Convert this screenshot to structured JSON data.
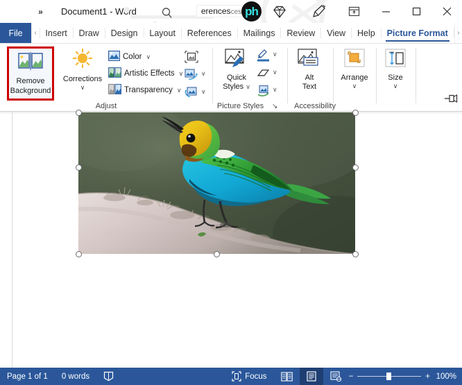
{
  "titlebar": {
    "qat_more": "»",
    "document_title": "Document1  -  Word",
    "search_fragment_main": "erences",
    "search_fragment_ghost": "ces",
    "logo_text": "ph",
    "ribbon_display_options": "ribbon-display-options",
    "minimize": "—",
    "maximize": "☐",
    "close": "✕"
  },
  "tabs": {
    "file": "File",
    "scroll_left": "‹",
    "scroll_right": "›",
    "items": [
      {
        "label": "Insert",
        "active": false
      },
      {
        "label": "Draw",
        "active": false
      },
      {
        "label": "Design",
        "active": false
      },
      {
        "label": "Layout",
        "active": false
      },
      {
        "label": "References",
        "active": false
      },
      {
        "label": "Mailings",
        "active": false
      },
      {
        "label": "Review",
        "active": false
      },
      {
        "label": "View",
        "active": false
      },
      {
        "label": "Help",
        "active": false
      },
      {
        "label": "Picture Format",
        "active": true
      }
    ]
  },
  "ribbon": {
    "groups": {
      "adjust": {
        "label": "Adjust",
        "remove_background": "Remove\nBackground",
        "remove_background_line1": "Remove",
        "remove_background_line2": "Background",
        "highlight_color": "#cc0000",
        "corrections": "Corrections",
        "color": "Color",
        "artistic_effects": "Artistic Effects",
        "transparency": "Transparency",
        "compress_pictures": "compress-pictures",
        "change_picture": "change-picture",
        "reset_picture": "reset-picture",
        "caret": "∨"
      },
      "picture_styles": {
        "label": "Picture Styles",
        "quick_styles_line1": "Quick",
        "quick_styles_line2": "Styles",
        "picture_border": "picture-border",
        "picture_effects": "picture-effects",
        "picture_layout": "picture-layout",
        "dialog_launcher": "↘",
        "caret": "∨"
      },
      "accessibility": {
        "label": "Accessibility",
        "alt_text_line1": "Alt",
        "alt_text_line2": "Text"
      },
      "arrange": {
        "label": "",
        "title": "Arrange",
        "caret": "∨"
      },
      "size": {
        "label": "",
        "title": "Size",
        "caret": "∨"
      }
    },
    "pin_ribbon": "pin-ribbon"
  },
  "document": {
    "image": {
      "alt": "Colorful tanager bird perched on a mossy branch",
      "selected": true,
      "handles": 8
    }
  },
  "statusbar": {
    "page": "Page 1 of 1",
    "words": "0 words",
    "proofing": "proofing-icon",
    "focus": "Focus",
    "read_mode": "read-mode-icon",
    "print_layout": "print-layout-icon",
    "web_layout": "web-layout-icon",
    "zoom_out": "−",
    "zoom_in": "+",
    "zoom_level": "100%"
  }
}
